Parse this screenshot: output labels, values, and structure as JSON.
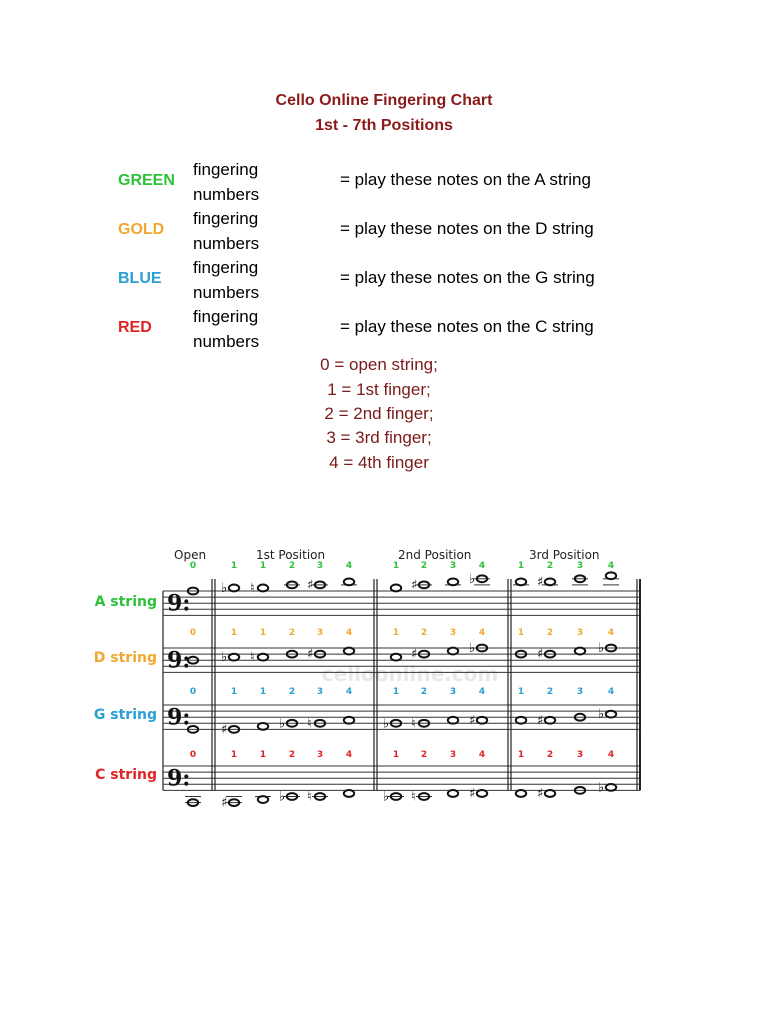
{
  "title": {
    "line1": "Cello Online Fingering Chart",
    "line2": "1st - 7th Positions"
  },
  "legend": [
    {
      "color_name": "GREEN",
      "color": "#2ec23a",
      "fingering_line1": "fingering",
      "fingering_line2": "numbers",
      "description": "=  play these notes on the A string"
    },
    {
      "color_name": "GOLD",
      "color": "#f0a830",
      "fingering_line1": "fingering",
      "fingering_line2": "numbers",
      "description": "=  play these notes on the D string"
    },
    {
      "color_name": "BLUE",
      "color": "#2a9fd6",
      "fingering_line1": "fingering",
      "fingering_line2": "numbers",
      "description": "=  play these notes on the G string"
    },
    {
      "color_name": "RED",
      "color": "#e02424",
      "fingering_line1": "fingering",
      "fingering_line2": "numbers",
      "description": "=  play these notes on the C string"
    }
  ],
  "finger_key": [
    "0 = open string;",
    "1 = 1st finger;",
    "2 = 2nd finger;",
    "3 = 3rd finger;",
    "4 = 4th finger"
  ],
  "chart": {
    "position_labels": [
      "Open",
      "1st Position",
      "2nd Position",
      "3rd Position"
    ],
    "watermark": "celloonline.com",
    "clef": "bass",
    "strings": [
      {
        "label": "A string",
        "color": "#2ec23a",
        "notes": [
          {
            "section": "open",
            "finger": "0",
            "pitch": "A3",
            "acc": ""
          },
          {
            "section": "1st",
            "finger": "1",
            "pitch": "B3",
            "acc": "flat"
          },
          {
            "section": "1st",
            "finger": "1",
            "pitch": "B3",
            "acc": "natural"
          },
          {
            "section": "1st",
            "finger": "2",
            "pitch": "C4",
            "acc": ""
          },
          {
            "section": "1st",
            "finger": "3",
            "pitch": "C4",
            "acc": "sharp"
          },
          {
            "section": "1st",
            "finger": "4",
            "pitch": "D4",
            "acc": ""
          },
          {
            "section": "2nd",
            "finger": "1",
            "pitch": "B3",
            "acc": ""
          },
          {
            "section": "2nd",
            "finger": "2",
            "pitch": "C4",
            "acc": "sharp"
          },
          {
            "section": "2nd",
            "finger": "3",
            "pitch": "D4",
            "acc": ""
          },
          {
            "section": "2nd",
            "finger": "4",
            "pitch": "E4",
            "acc": "flat"
          },
          {
            "section": "3rd",
            "finger": "1",
            "pitch": "D4",
            "acc": ""
          },
          {
            "section": "3rd",
            "finger": "2",
            "pitch": "D4",
            "acc": "sharp"
          },
          {
            "section": "3rd",
            "finger": "3",
            "pitch": "E4",
            "acc": ""
          },
          {
            "section": "3rd",
            "finger": "4",
            "pitch": "F4",
            "acc": ""
          }
        ]
      },
      {
        "label": "D string",
        "color": "#f0a830",
        "notes": [
          {
            "section": "open",
            "finger": "0",
            "pitch": "D3",
            "acc": ""
          },
          {
            "section": "1st",
            "finger": "1",
            "pitch": "E3",
            "acc": "flat"
          },
          {
            "section": "1st",
            "finger": "1",
            "pitch": "E3",
            "acc": "natural"
          },
          {
            "section": "1st",
            "finger": "2",
            "pitch": "F3",
            "acc": ""
          },
          {
            "section": "1st",
            "finger": "3",
            "pitch": "F3",
            "acc": "sharp"
          },
          {
            "section": "1st",
            "finger": "4",
            "pitch": "G3",
            "acc": ""
          },
          {
            "section": "2nd",
            "finger": "1",
            "pitch": "E3",
            "acc": ""
          },
          {
            "section": "2nd",
            "finger": "2",
            "pitch": "F3",
            "acc": "sharp"
          },
          {
            "section": "2nd",
            "finger": "3",
            "pitch": "G3",
            "acc": ""
          },
          {
            "section": "2nd",
            "finger": "4",
            "pitch": "A3",
            "acc": "flat"
          },
          {
            "section": "3rd",
            "finger": "1",
            "pitch": "F3",
            "acc": ""
          },
          {
            "section": "3rd",
            "finger": "2",
            "pitch": "F3",
            "acc": "sharp"
          },
          {
            "section": "3rd",
            "finger": "3",
            "pitch": "G3",
            "acc": ""
          },
          {
            "section": "3rd",
            "finger": "4",
            "pitch": "A3",
            "acc": "flat"
          }
        ]
      },
      {
        "label": "G string",
        "color": "#2a9fd6",
        "notes": [
          {
            "section": "open",
            "finger": "0",
            "pitch": "G2",
            "acc": ""
          },
          {
            "section": "1st",
            "finger": "1",
            "pitch": "G2",
            "acc": "sharp"
          },
          {
            "section": "1st",
            "finger": "1",
            "pitch": "A2",
            "acc": ""
          },
          {
            "section": "1st",
            "finger": "2",
            "pitch": "B2",
            "acc": "flat"
          },
          {
            "section": "1st",
            "finger": "3",
            "pitch": "B2",
            "acc": "natural"
          },
          {
            "section": "1st",
            "finger": "4",
            "pitch": "C3",
            "acc": ""
          },
          {
            "section": "2nd",
            "finger": "1",
            "pitch": "B2",
            "acc": "flat"
          },
          {
            "section": "2nd",
            "finger": "2",
            "pitch": "B2",
            "acc": "natural"
          },
          {
            "section": "2nd",
            "finger": "3",
            "pitch": "C3",
            "acc": ""
          },
          {
            "section": "2nd",
            "finger": "4",
            "pitch": "C3",
            "acc": "sharp"
          },
          {
            "section": "3rd",
            "finger": "1",
            "pitch": "C3",
            "acc": ""
          },
          {
            "section": "3rd",
            "finger": "2",
            "pitch": "C3",
            "acc": "sharp"
          },
          {
            "section": "3rd",
            "finger": "3",
            "pitch": "D3",
            "acc": ""
          },
          {
            "section": "3rd",
            "finger": "4",
            "pitch": "E3",
            "acc": "flat"
          }
        ]
      },
      {
        "label": "C string",
        "color": "#e02424",
        "notes": [
          {
            "section": "open",
            "finger": "0",
            "pitch": "C2",
            "acc": ""
          },
          {
            "section": "1st",
            "finger": "1",
            "pitch": "C2",
            "acc": "sharp"
          },
          {
            "section": "1st",
            "finger": "1",
            "pitch": "D2",
            "acc": ""
          },
          {
            "section": "1st",
            "finger": "2",
            "pitch": "E2",
            "acc": "flat"
          },
          {
            "section": "1st",
            "finger": "3",
            "pitch": "E2",
            "acc": "natural"
          },
          {
            "section": "1st",
            "finger": "4",
            "pitch": "F2",
            "acc": ""
          },
          {
            "section": "2nd",
            "finger": "1",
            "pitch": "E2",
            "acc": "flat"
          },
          {
            "section": "2nd",
            "finger": "2",
            "pitch": "E2",
            "acc": "natural"
          },
          {
            "section": "2nd",
            "finger": "3",
            "pitch": "F2",
            "acc": ""
          },
          {
            "section": "2nd",
            "finger": "4",
            "pitch": "F2",
            "acc": "sharp"
          },
          {
            "section": "3rd",
            "finger": "1",
            "pitch": "F2",
            "acc": ""
          },
          {
            "section": "3rd",
            "finger": "2",
            "pitch": "F2",
            "acc": "sharp"
          },
          {
            "section": "3rd",
            "finger": "3",
            "pitch": "G2",
            "acc": ""
          },
          {
            "section": "3rd",
            "finger": "4",
            "pitch": "A2",
            "acc": "flat"
          }
        ]
      }
    ]
  }
}
